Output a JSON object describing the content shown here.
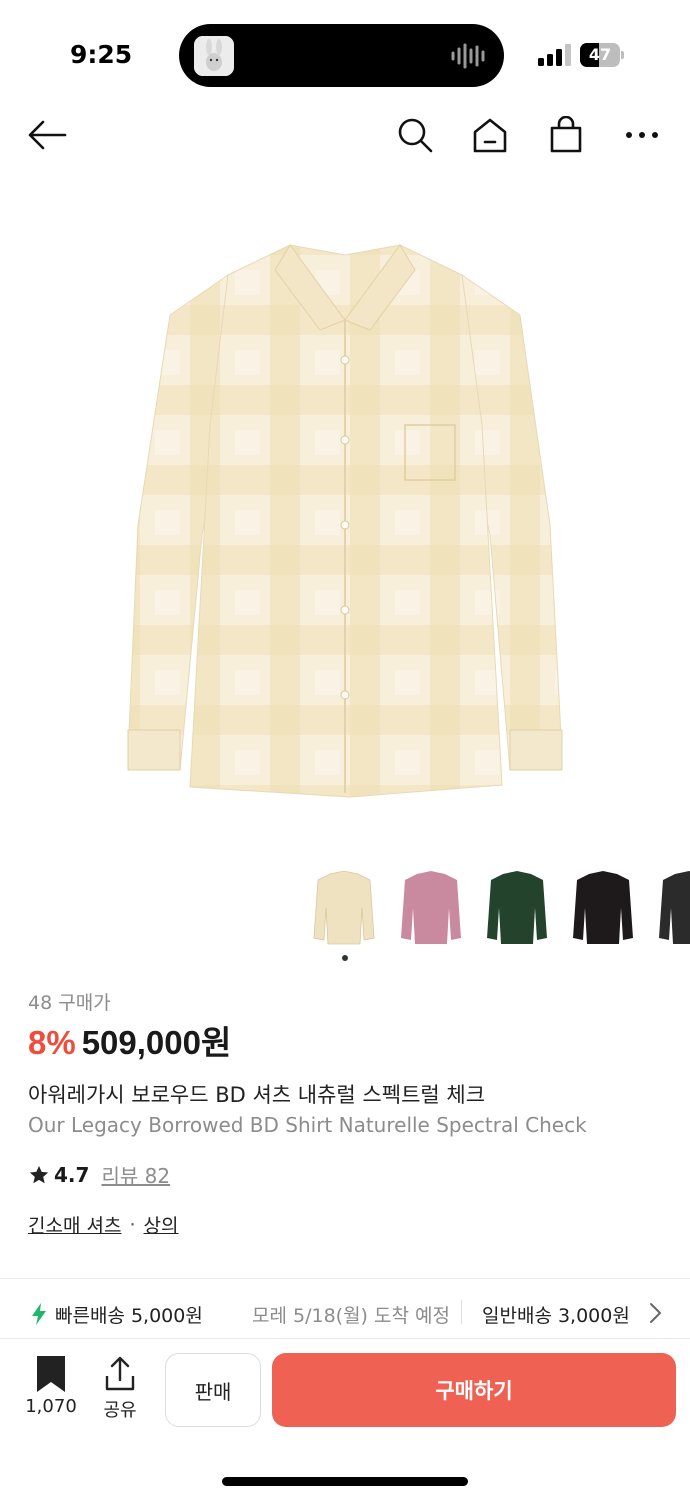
{
  "status_bar": {
    "time": "9:25",
    "battery": "47",
    "battery_level": 0.47
  },
  "nav": {
    "back_icon": "arrow-left-icon",
    "search_icon": "search-icon",
    "home_icon": "home-icon",
    "cart_icon": "shopping-bag-icon",
    "more_icon": "more-horizontal-icon"
  },
  "product": {
    "purchase_count": "48 구매가",
    "discount": "8%",
    "price": "509,000원",
    "title_ko": "아워레가시 보로우드 BD 셔츠 내츄럴 스펙트럴 체크",
    "title_en": "Our Legacy Borrowed BD Shirt Naturelle Spectral Check",
    "rating": "4.7",
    "reviews": "리뷰 82",
    "category_1": "긴소매 셔츠",
    "category_sep": "·",
    "category_2": "상의",
    "colors": {
      "discount": "#ef4d3b",
      "accent": "#ef6253",
      "shirt_main": "#f6ecd2"
    }
  },
  "thumbnails": [
    {
      "name": "cream check",
      "color": "#efe2c0"
    },
    {
      "name": "pink check",
      "color": "#c98a9f"
    },
    {
      "name": "green check",
      "color": "#23432d"
    },
    {
      "name": "black",
      "color": "#1e1a1c"
    },
    {
      "name": "charcoal",
      "color": "#2b2b2b"
    }
  ],
  "delivery": {
    "fast_label": "빠른배송 5,000원",
    "fast_date": "모레 5/18(월) 도착 예정",
    "normal_label": "일반배송 3,000원"
  },
  "bottom_bar": {
    "bookmark_count": "1,070",
    "share_label": "공유",
    "sell_label": "판매",
    "buy_label": "구매하기"
  }
}
